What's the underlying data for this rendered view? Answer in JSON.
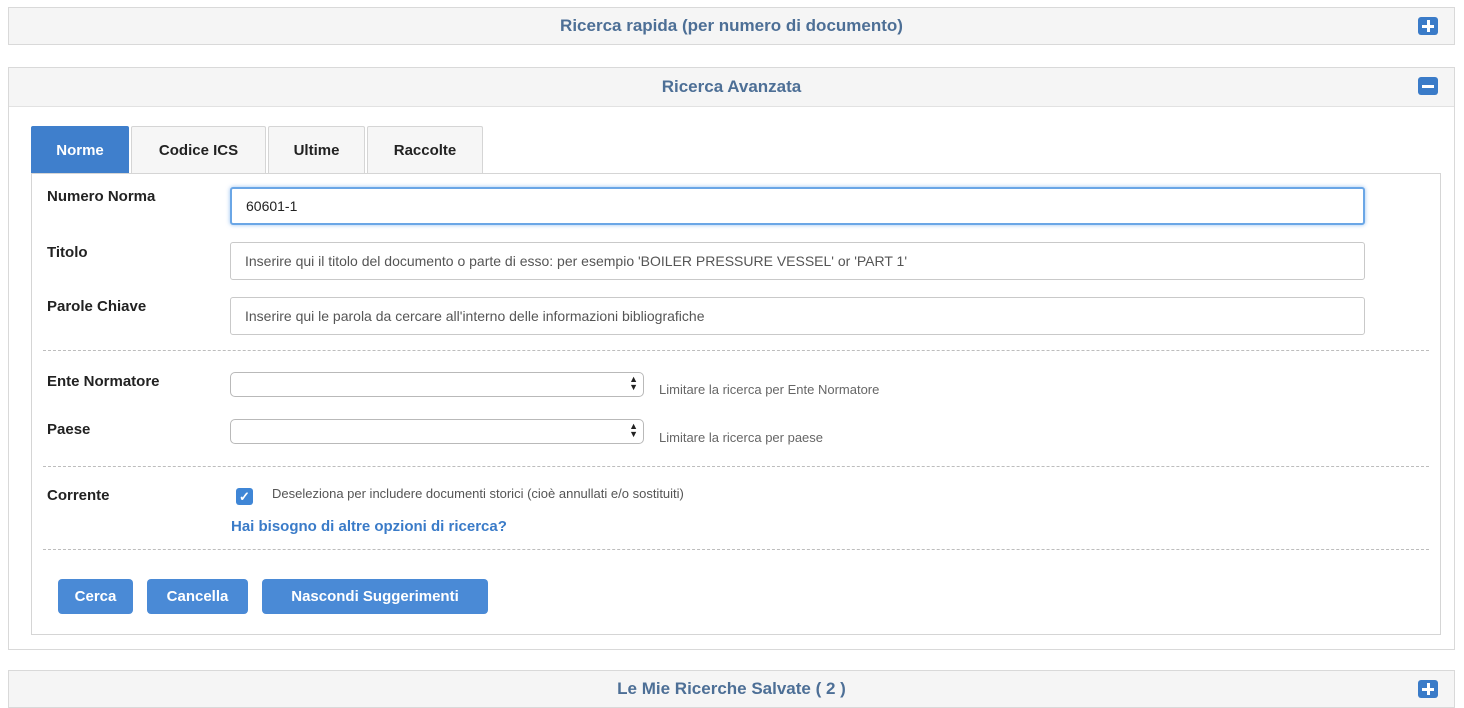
{
  "quick_search": {
    "title": "Ricerca rapida (per numero di documento)",
    "toggle": "plus-icon"
  },
  "advanced_search": {
    "title": "Ricerca Avanzata",
    "toggle": "minus-icon",
    "tabs": [
      {
        "label": "Norme",
        "active": true
      },
      {
        "label": "Codice ICS",
        "active": false
      },
      {
        "label": "Ultime",
        "active": false
      },
      {
        "label": "Raccolte",
        "active": false
      }
    ],
    "fields": {
      "numero_norma": {
        "label": "Numero Norma",
        "value": "60601-1"
      },
      "titolo": {
        "label": "Titolo",
        "placeholder": "Inserire qui il titolo del documento o parte di esso: per esempio 'BOILER PRESSURE VESSEL' or 'PART 1'"
      },
      "parole_chiave": {
        "label": "Parole Chiave",
        "placeholder": "Inserire qui le parola da cercare all'interno delle informazioni bibliografiche"
      },
      "ente_normatore": {
        "label": "Ente Normatore",
        "value": "",
        "hint": "Limitare la ricerca per Ente Normatore"
      },
      "paese": {
        "label": "Paese",
        "value": "",
        "hint": "Limitare la ricerca per paese"
      },
      "corrente": {
        "label": "Corrente",
        "checked": true,
        "text": "Deseleziona per includere documenti storici (cioè annullati e/o sostituiti)"
      }
    },
    "more_options_link": "Hai bisogno di altre opzioni di ricerca?",
    "buttons": {
      "search": "Cerca",
      "clear": "Cancella",
      "hide_hints": "Nascondi Suggerimenti"
    }
  },
  "saved_searches": {
    "title": "Le Mie Ricerche Salvate ( 2 )",
    "toggle": "plus-icon"
  },
  "colors": {
    "accent": "#3f7fcc",
    "panel_title": "#4d6f96",
    "link": "#3a7bc8"
  }
}
